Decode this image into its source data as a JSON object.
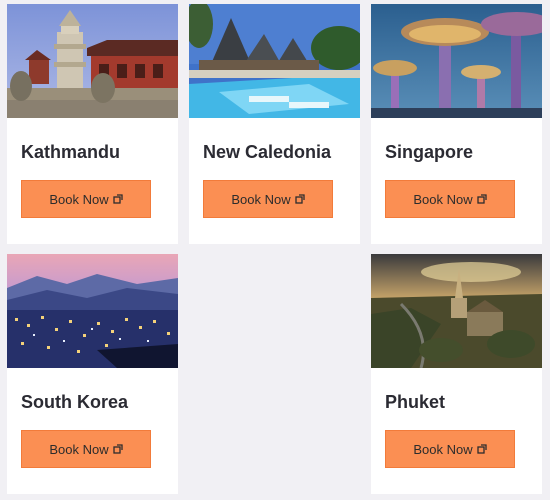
{
  "destinations": [
    {
      "name": "Kathmandu",
      "button": "Book Now",
      "image": "kathmandu-temple-photo"
    },
    {
      "name": "New Caledonia",
      "button": "Book Now",
      "image": "new-caledonia-resort-photo"
    },
    {
      "name": "Singapore",
      "button": "Book Now",
      "image": "singapore-supertrees-photo"
    },
    {
      "name": "South Korea",
      "button": "Book Now",
      "image": "seoul-night-skyline-photo"
    },
    {
      "name": "Phuket",
      "button": "Book Now",
      "image": "phuket-aerial-photo"
    }
  ],
  "colors": {
    "button": "#fb8f53",
    "card": "#ffffff",
    "background": "#f1f0f4",
    "title": "#2b2b33"
  },
  "icons": {
    "button_icon": "external-link-icon"
  }
}
